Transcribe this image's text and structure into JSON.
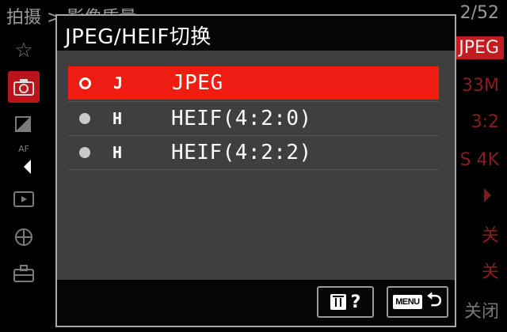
{
  "background": {
    "breadcrumb": "拍摄 > 影像质量",
    "page_indicator": "2/52",
    "sidebar_icons": [
      "star-icon",
      "camera-icon",
      "exposure-icon",
      "af-icon",
      "playback-icon",
      "network-icon",
      "toolbox-icon"
    ],
    "values": [
      "JPEG",
      "33M",
      "3:2",
      "S 4K",
      "关",
      "关",
      "关闭"
    ]
  },
  "dialog": {
    "title": "JPEG/HEIF切换",
    "options": [
      {
        "icon": "J",
        "label": "JPEG",
        "selected": true
      },
      {
        "icon": "H",
        "label": "HEIF(4:2:0)",
        "selected": false
      },
      {
        "icon": "H",
        "label": "HEIF(4:2:2)",
        "selected": false
      }
    ],
    "footer": {
      "help_glyph": "?",
      "menu_label": "MENU",
      "back_glyph": "⮌"
    }
  },
  "colors": {
    "accent": "#ee1c11",
    "dialog_bg": "#3f3f3f",
    "bar_bg": "#050505"
  }
}
